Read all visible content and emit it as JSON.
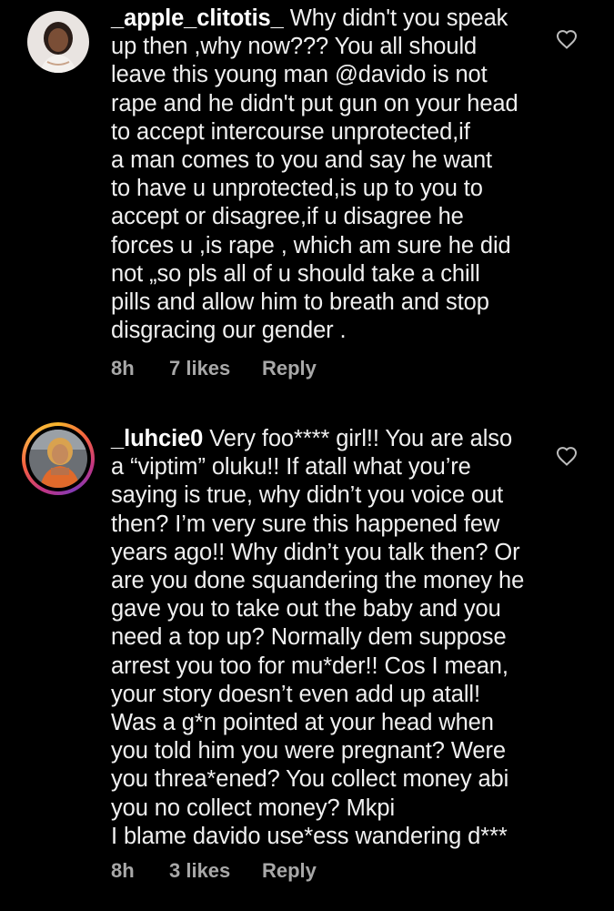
{
  "comments": [
    {
      "username": "_apple_clitotis_",
      "text": "Why didn't you speak\nup then ,why now??? You all should\nleave this young man @davido is not\nrape and he didn't put gun on your head\nto accept intercourse unprotected,if\na man comes to you and say he want\nto have u unprotected,is up to you to\naccept or disagree,if u disagree he\nforces u ,is rape , which am sure he did\nnot „so pls all of u should take a chill\npills and allow him to breath and stop\ndisgracing our gender .",
      "time": "8h",
      "likes": "7 likes",
      "reply": "Reply",
      "heart_icon": "heart-outline-icon"
    },
    {
      "username": "_luhcie0",
      "text": "Very foo**** girl!! You are also\na “viptim” oluku!! If atall what you’re\nsaying is true, why didn’t you voice out\nthen? I’m very sure this happened few\nyears ago!! Why didn’t you talk then? Or\nare you done squandering the money he\ngave you to take out the baby and you\nneed a top up? Normally dem suppose\narrest you too for mu*der!! Cos I mean,\nyour story doesn’t even add up atall!\nWas a g*n pointed at your head when\nyou told him you were pregnant? Were\nyou threa*ened? You collect money abi\nyou no collect money? Mkpi\nI blame davido use*ess wandering d***",
      "time": "8h",
      "likes": "3 likes",
      "reply": "Reply",
      "heart_icon": "heart-outline-icon"
    }
  ],
  "colors": {
    "background": "#000000",
    "text": "#f0f0f0",
    "meta": "#a8a8a8"
  }
}
